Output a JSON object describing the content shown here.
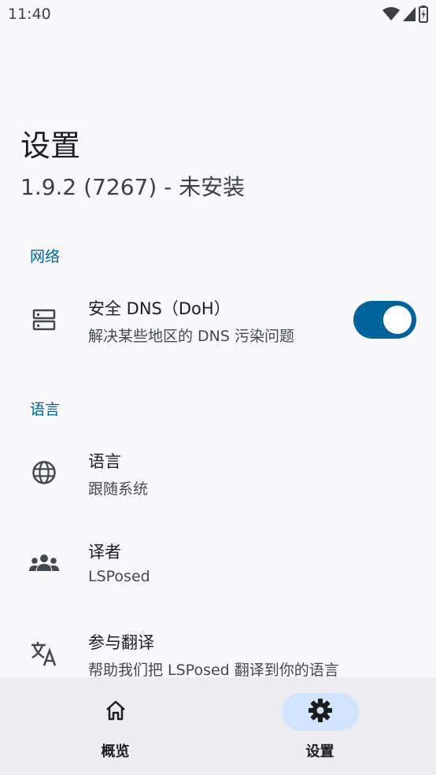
{
  "status_bar": {
    "time": "11:40",
    "icons": [
      "wifi-icon",
      "signal-icon",
      "battery-icon"
    ]
  },
  "header": {
    "title": "设置",
    "subtitle": "1.9.2 (7267) - 未安装"
  },
  "sections": {
    "network": {
      "header": "网络",
      "doh": {
        "icon": "dns-server-icon",
        "title": "安全 DNS（DoH）",
        "summary": "解决某些地区的 DNS 污染问题",
        "enabled": true
      }
    },
    "language": {
      "header": "语言",
      "language_item": {
        "icon": "globe-icon",
        "title": "语言",
        "summary": "跟随系统"
      },
      "translators": {
        "icon": "group-icon",
        "title": "译者",
        "summary": "LSPosed"
      },
      "translate": {
        "icon": "translate-icon",
        "title": "参与翻译",
        "summary": "帮助我们把 LSPosed 翻译到你的语言"
      }
    }
  },
  "nav": {
    "items": [
      {
        "label": "概览",
        "icon": "home-icon",
        "active": false
      },
      {
        "label": "设置",
        "icon": "gear-icon",
        "active": true
      }
    ]
  },
  "colors": {
    "accent": "#00639b",
    "background": "#f9f9fc",
    "nav_background": "#ededf1",
    "nav_active_pill": "#d1e4ff"
  }
}
